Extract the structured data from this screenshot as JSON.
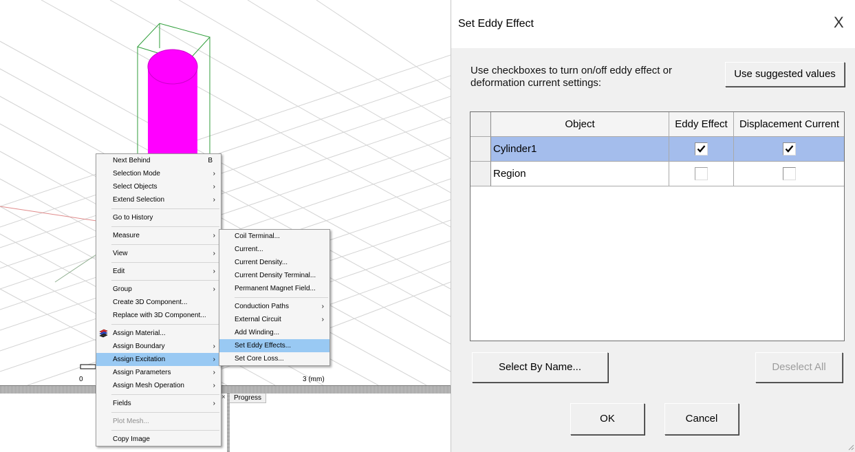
{
  "viewport": {
    "scale_zero": "0",
    "scale_end": "3 (mm)",
    "progress_tab": "Progress",
    "close_symbol": "×",
    "colors": {
      "cylinder": "#ff00ff",
      "grid": "#cfcfcf",
      "bounding_box": "#2f9e3a"
    }
  },
  "main_menu": {
    "items": [
      {
        "label": "Next Behind",
        "accel": "B"
      },
      {
        "label": "Selection Mode",
        "submenu": true
      },
      {
        "label": "Select Objects",
        "submenu": true
      },
      {
        "label": "Extend Selection",
        "submenu": true
      },
      {
        "label": "Go to History"
      },
      {
        "label": "Measure",
        "submenu": true
      },
      {
        "label": "View",
        "submenu": true
      },
      {
        "label": "Edit",
        "submenu": true
      },
      {
        "label": "Group",
        "submenu": true
      },
      {
        "label": "Create 3D Component..."
      },
      {
        "label": "Replace with 3D Component..."
      },
      {
        "label": "Assign Material...",
        "icon": "assign-material-icon"
      },
      {
        "label": "Assign Boundary",
        "submenu": true
      },
      {
        "label": "Assign Excitation",
        "submenu": true,
        "highlighted": true
      },
      {
        "label": "Assign Parameters",
        "submenu": true
      },
      {
        "label": "Assign Mesh Operation",
        "submenu": true
      },
      {
        "label": "Fields",
        "submenu": true
      },
      {
        "label": "Plot Mesh...",
        "disabled": true
      },
      {
        "label": "Copy Image"
      }
    ],
    "arrow": "›"
  },
  "sub_menu": {
    "items": [
      {
        "label": "Coil Terminal..."
      },
      {
        "label": "Current..."
      },
      {
        "label": "Current Density..."
      },
      {
        "label": "Current Density Terminal..."
      },
      {
        "label": "Permanent Magnet Field..."
      },
      {
        "label": "Conduction Paths",
        "submenu": true
      },
      {
        "label": "External Circuit",
        "submenu": true
      },
      {
        "label": "Add Winding..."
      },
      {
        "label": "Set Eddy Effects...",
        "highlighted": true
      },
      {
        "label": "Set Core Loss..."
      }
    ]
  },
  "dialog": {
    "title": "Set Eddy Effect",
    "close_symbol": "X",
    "instructions": "Use checkboxes to turn on/off eddy effect or deformation current settings:",
    "suggested_button": "Use suggested values",
    "columns": [
      "Object",
      "Eddy Effect",
      "Displacement Current"
    ],
    "rows": [
      {
        "object": "Cylinder1",
        "eddy_effect": true,
        "displacement_current": true,
        "selected": true
      },
      {
        "object": "Region",
        "eddy_effect": false,
        "displacement_current": false,
        "selected": false
      }
    ],
    "select_by_name_button": "Select By Name...",
    "deselect_all_button": "Deselect All",
    "ok_button": "OK",
    "cancel_button": "Cancel",
    "colors": {
      "selected_row": "#a4bdec",
      "body": "#f0f0f0"
    }
  }
}
